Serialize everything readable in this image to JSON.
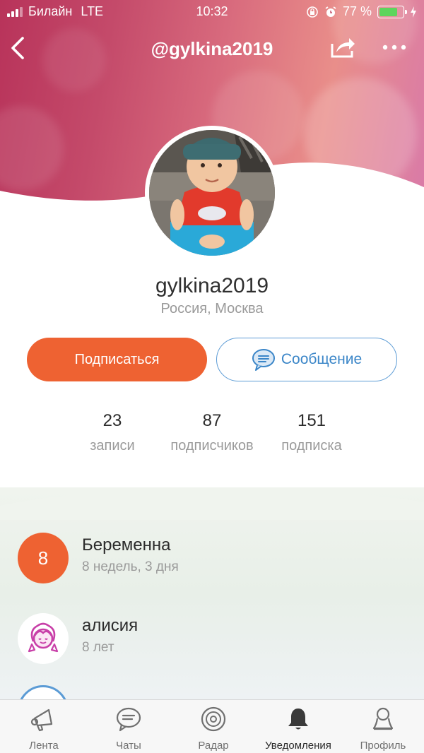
{
  "status_bar": {
    "carrier": "Билайн",
    "network": "LTE",
    "time": "10:32",
    "battery_percent": "77 %",
    "battery_level": 0.77
  },
  "nav": {
    "title": "@gylkina2019"
  },
  "profile": {
    "username": "gylkina2019",
    "location": "Россия, Москва"
  },
  "actions": {
    "subscribe_label": "Подписаться",
    "message_label": "Сообщение"
  },
  "stats": [
    {
      "value": "23",
      "label": "записи"
    },
    {
      "value": "87",
      "label": "подписчиков"
    },
    {
      "value": "151",
      "label": "подписка"
    }
  ],
  "children": [
    {
      "badge": "8",
      "name": "Беременна",
      "sub": "8 недель, 3 дня"
    },
    {
      "badge": "",
      "name": "алисия",
      "sub": "8 лет"
    }
  ],
  "tabs": [
    {
      "label": "Лента",
      "icon": "megaphone-icon"
    },
    {
      "label": "Чаты",
      "icon": "chat-icon"
    },
    {
      "label": "Радар",
      "icon": "radar-icon"
    },
    {
      "label": "Уведомления",
      "icon": "bell-icon"
    },
    {
      "label": "Профиль",
      "icon": "profile-icon"
    }
  ],
  "colors": {
    "accent": "#ee6232",
    "link": "#3b86c8",
    "girl_icon": "#c83fa8"
  }
}
